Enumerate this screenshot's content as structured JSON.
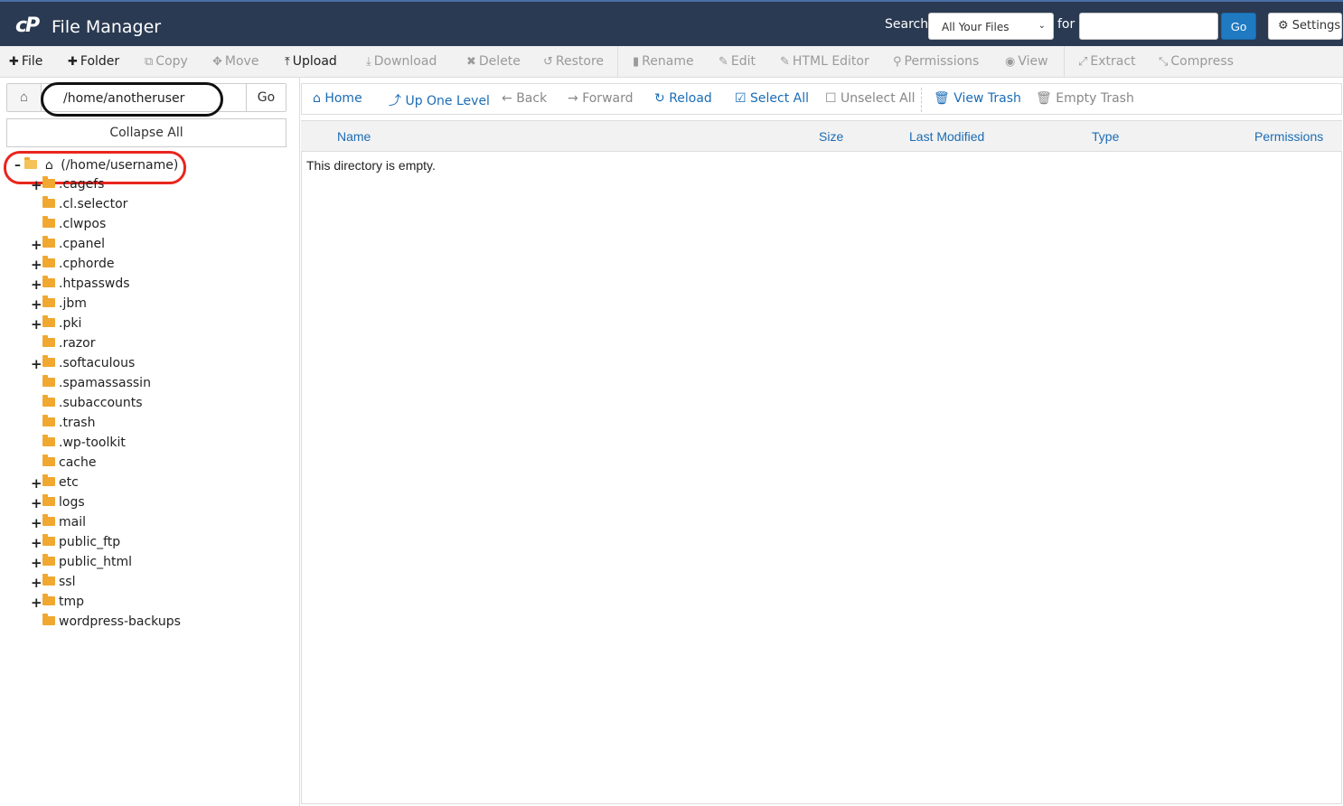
{
  "header": {
    "logo": "cP",
    "title": "File Manager",
    "search_label": "Search",
    "search_scope": "All Your Files",
    "for_label": "for",
    "search_value": "",
    "go_label": "Go",
    "settings_label": "Settings"
  },
  "toolbar": {
    "items": [
      {
        "label": "File",
        "icon": "plus-icon",
        "enabled": true
      },
      {
        "label": "Folder",
        "icon": "plus-icon",
        "enabled": true
      },
      {
        "label": "Copy",
        "icon": "copy-icon",
        "enabled": false
      },
      {
        "label": "Move",
        "icon": "move-icon",
        "enabled": false
      },
      {
        "label": "Upload",
        "icon": "upload-icon",
        "enabled": true
      },
      {
        "label": "Download",
        "icon": "download-icon",
        "enabled": false
      },
      {
        "label": "Delete",
        "icon": "delete-icon",
        "enabled": false
      },
      {
        "label": "Restore",
        "icon": "restore-icon",
        "enabled": false
      },
      {
        "label": "Rename",
        "icon": "file-icon",
        "enabled": false
      },
      {
        "label": "Edit",
        "icon": "pencil-icon",
        "enabled": false
      },
      {
        "label": "HTML Editor",
        "icon": "edit-square-icon",
        "enabled": false
      },
      {
        "label": "Permissions",
        "icon": "key-icon",
        "enabled": false
      },
      {
        "label": "View",
        "icon": "eye-icon",
        "enabled": false
      },
      {
        "label": "Extract",
        "icon": "expand-icon",
        "enabled": false
      },
      {
        "label": "Compress",
        "icon": "compress-icon",
        "enabled": false
      }
    ]
  },
  "left": {
    "path_value": "/home/anotheruser",
    "go_label": "Go",
    "collapse_label": "Collapse All",
    "root_label": "(/home/username)",
    "tree": [
      {
        "label": ".cagefs",
        "expandable": true
      },
      {
        "label": ".cl.selector",
        "expandable": false
      },
      {
        "label": ".clwpos",
        "expandable": false
      },
      {
        "label": ".cpanel",
        "expandable": true
      },
      {
        "label": ".cphorde",
        "expandable": true
      },
      {
        "label": ".htpasswds",
        "expandable": true
      },
      {
        "label": ".jbm",
        "expandable": true
      },
      {
        "label": ".pki",
        "expandable": true
      },
      {
        "label": ".razor",
        "expandable": false
      },
      {
        "label": ".softaculous",
        "expandable": true
      },
      {
        "label": ".spamassassin",
        "expandable": false
      },
      {
        "label": ".subaccounts",
        "expandable": false
      },
      {
        "label": ".trash",
        "expandable": false
      },
      {
        "label": ".wp-toolkit",
        "expandable": false
      },
      {
        "label": "cache",
        "expandable": false
      },
      {
        "label": "etc",
        "expandable": true
      },
      {
        "label": "logs",
        "expandable": true
      },
      {
        "label": "mail",
        "expandable": true
      },
      {
        "label": "public_ftp",
        "expandable": true
      },
      {
        "label": "public_html",
        "expandable": true
      },
      {
        "label": "ssl",
        "expandable": true
      },
      {
        "label": "tmp",
        "expandable": true
      },
      {
        "label": "wordpress-backups",
        "expandable": false
      }
    ]
  },
  "nav": {
    "home": "Home",
    "up": "Up One Level",
    "back": "Back",
    "forward": "Forward",
    "reload": "Reload",
    "select_all": "Select All",
    "unselect_all": "Unselect All",
    "view_trash": "View Trash",
    "empty_trash": "Empty Trash"
  },
  "table": {
    "columns": [
      "Name",
      "Size",
      "Last Modified",
      "Type",
      "Permissions"
    ],
    "empty_message": "This directory is empty."
  },
  "colors": {
    "header_bg": "#2a3a52",
    "accent": "#1b6cb5",
    "folder": "#f0a830",
    "annotation_red": "#e8261d"
  }
}
